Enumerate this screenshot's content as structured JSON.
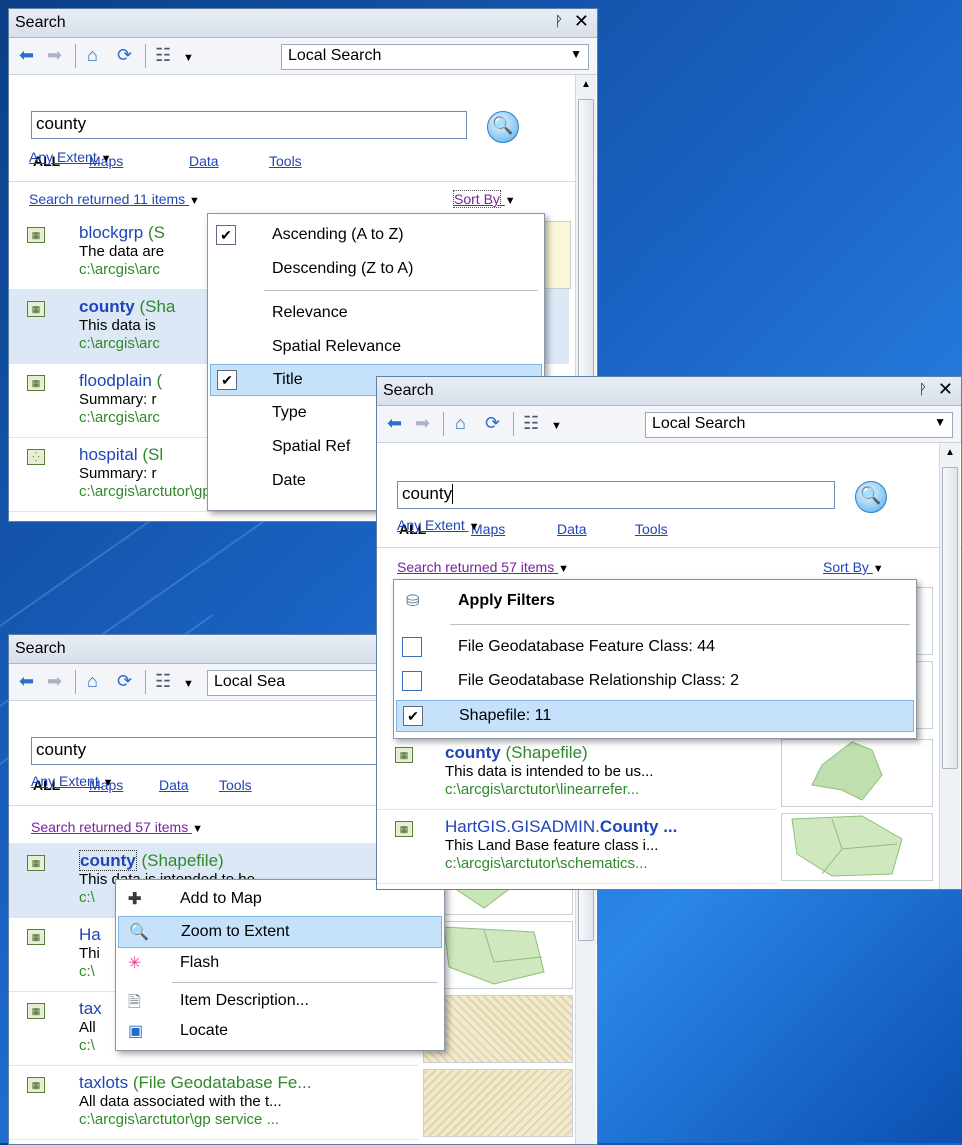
{
  "panel_common": {
    "title": "Search",
    "pin": "ᚹ",
    "close": "✕",
    "scope": "Local Search",
    "tabs": {
      "all": "ALL",
      "maps": "Maps",
      "data": "Data",
      "tools": "Tools"
    },
    "query": "county",
    "extent": "Any Extent",
    "sort_by": "Sort By"
  },
  "panel1": {
    "returned": "Search returned 11 items",
    "results": [
      {
        "name": "blockgrp",
        "type": "(S",
        "desc": "The data are",
        "path": "c:\\arcgis\\arc"
      },
      {
        "name": "county",
        "type": "(Sha",
        "desc": "This data is",
        "path": "c:\\arcgis\\arc"
      },
      {
        "name": "floodplain",
        "type": "(",
        "desc": "Summary: r",
        "path": "c:\\arcgis\\arc"
      },
      {
        "name": "hospital",
        "type": "(Sl",
        "desc": "Summary: r",
        "path": "c:\\arcgis\\arctutor\\gp service"
      }
    ],
    "sort_menu": [
      {
        "label": "Ascending (A to Z)",
        "checked": true
      },
      {
        "label": "Descending (Z to A)",
        "checked": false
      },
      {
        "label": "Relevance",
        "checked": false
      },
      {
        "label": "Spatial Relevance",
        "checked": false
      },
      {
        "label": "Title",
        "checked": true
      },
      {
        "label": "Type",
        "checked": false
      },
      {
        "label": "Spatial Ref",
        "checked": false
      },
      {
        "label": "Date",
        "checked": false
      }
    ]
  },
  "panel2": {
    "returned": "Search returned 57 items",
    "filters_title": "Apply Filters",
    "filters": [
      {
        "label": "File Geodatabase Feature Class: 44",
        "checked": false
      },
      {
        "label": "File Geodatabase Relationship Class: 2",
        "checked": false
      },
      {
        "label": "Shapefile: 11",
        "checked": true
      }
    ],
    "results": [
      {
        "name": "county",
        "type": "(Shapefile)",
        "desc": "This data is intended to be us...",
        "path": "c:\\arcgis\\arctutor\\linearrefer..."
      },
      {
        "name_prefix": "HartGIS.GISADMIN.",
        "name": "County ...",
        "desc": "This Land Base feature class i...",
        "path": "c:\\arcgis\\arctutor\\schematics..."
      }
    ]
  },
  "panel3": {
    "scope": "Local Sea",
    "returned": "Search returned 57 items",
    "results": [
      {
        "name": "county",
        "type": "(Shapefile)",
        "desc": "This data is intended to be",
        "path": "c:\\"
      },
      {
        "name": "Ha",
        "desc": "Thi",
        "path": "c:\\"
      },
      {
        "name": "tax",
        "desc": "All",
        "path": "c:\\"
      },
      {
        "name": "taxlots",
        "type": "(File Geodatabase Fe...",
        "desc": "All data associated with the t...",
        "path": "c:\\arcgis\\arctutor\\gp service ..."
      }
    ],
    "context_menu": [
      {
        "label": "Add to Map",
        "icon": "add-icon"
      },
      {
        "label": "Zoom to Extent",
        "icon": "zoom-icon"
      },
      {
        "label": "Flash",
        "icon": "flash-icon"
      },
      {
        "label": "Item Description...",
        "icon": "document-icon"
      },
      {
        "label": "Locate",
        "icon": "locate-icon"
      }
    ]
  },
  "colors": {
    "link": "#1f45b8",
    "path": "#2f8a2a",
    "highlight": "#c6e2fb"
  }
}
